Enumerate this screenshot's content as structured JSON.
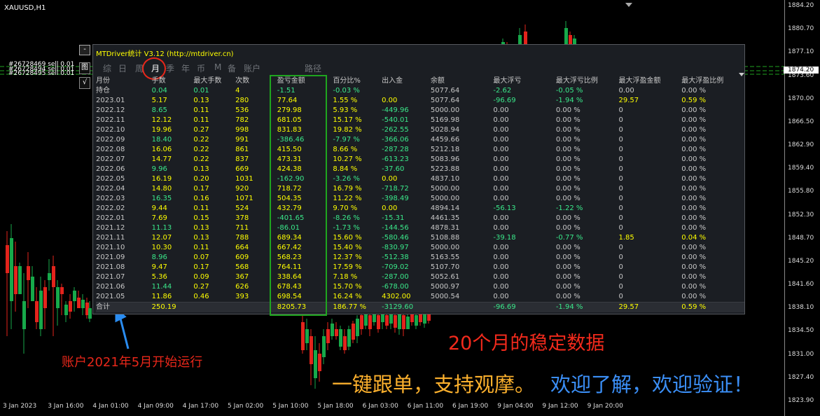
{
  "window": {
    "symbol": "XAUUSD,H1"
  },
  "colors": {
    "bull": "#17a94a",
    "bear": "#e3241c",
    "text_yellow": "#ffff00",
    "text_green": "#3ae88a",
    "box_green": "#1fa51f",
    "annotation_red": "#f22a1c",
    "annotation_orange": "#fbb02d",
    "annotation_blue": "#3b8ff7"
  },
  "price_axis": {
    "labels": [
      "1884.20",
      "1880.70",
      "1877.10",
      "1873.60",
      "1870.00",
      "1866.50",
      "1862.90",
      "1859.40",
      "1855.80",
      "1852.30",
      "1848.70",
      "1845.20",
      "1841.60",
      "1838.10",
      "1834.50",
      "1831.00",
      "1827.40",
      "1823.90"
    ],
    "current": "1874.20"
  },
  "time_axis": [
    "3 Jan 2023",
    "3 Jan 16:00",
    "4 Jan 01:00",
    "4 Jan 09:00",
    "4 Jan 17:00",
    "5 Jan 02:00",
    "5 Jan 10:00",
    "5 Jan 18:00",
    "6 Jan 03:00",
    "6 Jan 11:00",
    "6 Jan 19:00",
    "9 Jan 04:00",
    "9 Jan 12:00",
    "9 Jan 20:00"
  ],
  "orders": [
    "#26728469 sell 0.01",
    "#26728494 sell 0.01",
    "#26728495 sell 0.01"
  ],
  "panel": {
    "title": "MTDriver统计  V3.12 (http://mtdriver.cn)",
    "collapse_label": "-",
    "side_buttons": [
      "图",
      "√"
    ],
    "tabs": [
      "综",
      "日",
      "周",
      "月",
      "季",
      "年",
      "币",
      "M",
      "备",
      "账户",
      "路径"
    ],
    "active_tab": "月",
    "headers": [
      "月份",
      "手数",
      "最大手数",
      "次数",
      "盈亏金额",
      "百分比%",
      "出入金",
      "余额",
      "最大浮亏",
      "最大浮亏比例",
      "最大浮盈金额",
      "最大浮盈比例"
    ],
    "rows": [
      [
        "持仓",
        "0.04",
        "0.01",
        "4",
        "-1.51",
        "-0.03 %",
        "",
        "5077.64",
        "-2.62",
        "-0.05 %",
        "0.00",
        "0.00 %"
      ],
      [
        "2023.01",
        "5.17",
        "0.13",
        "280",
        "77.64",
        "1.55 %",
        "0.00",
        "5077.64",
        "-96.69",
        "-1.94 %",
        "29.57",
        "0.59 %"
      ],
      [
        "2022.12",
        "8.65",
        "0.11",
        "536",
        "279.98",
        "5.93 %",
        "-449.96",
        "5000.00",
        "0.00",
        "0.00 %",
        "0",
        "0.00 %"
      ],
      [
        "2022.11",
        "12.12",
        "0.11",
        "782",
        "681.05",
        "15.17 %",
        "-540.01",
        "5169.98",
        "0.00",
        "0.00 %",
        "0",
        "0.00 %"
      ],
      [
        "2022.10",
        "19.96",
        "0.27",
        "998",
        "831.83",
        "19.82 %",
        "-262.55",
        "5028.94",
        "0.00",
        "0.00 %",
        "0",
        "0.00 %"
      ],
      [
        "2022.09",
        "18.40",
        "0.22",
        "991",
        "-386.46",
        "-7.97 %",
        "-366.06",
        "4459.66",
        "0.00",
        "0.00 %",
        "0",
        "0.00 %"
      ],
      [
        "2022.08",
        "16.06",
        "0.22",
        "861",
        "415.50",
        "8.66 %",
        "-287.28",
        "5212.18",
        "0.00",
        "0.00 %",
        "0",
        "0.00 %"
      ],
      [
        "2022.07",
        "14.77",
        "0.22",
        "837",
        "473.31",
        "10.27 %",
        "-613.23",
        "5083.96",
        "0.00",
        "0.00 %",
        "0",
        "0.00 %"
      ],
      [
        "2022.06",
        "9.96",
        "0.13",
        "669",
        "424.38",
        "8.84 %",
        "-37.60",
        "5223.88",
        "0.00",
        "0.00 %",
        "0",
        "0.00 %"
      ],
      [
        "2022.05",
        "16.19",
        "0.20",
        "1031",
        "-162.90",
        "-3.26 %",
        "0.00",
        "4837.10",
        "0.00",
        "0.00 %",
        "0",
        "0.00 %"
      ],
      [
        "2022.04",
        "14.80",
        "0.17",
        "920",
        "718.72",
        "16.79 %",
        "-718.72",
        "5000.00",
        "0.00",
        "0.00 %",
        "0",
        "0.00 %"
      ],
      [
        "2022.03",
        "16.35",
        "0.16",
        "1071",
        "504.35",
        "11.22 %",
        "-398.49",
        "5000.00",
        "0.00",
        "0.00 %",
        "0",
        "0.00 %"
      ],
      [
        "2022.02",
        "9.44",
        "0.11",
        "524",
        "432.79",
        "9.70 %",
        "0.00",
        "4894.14",
        "-56.13",
        "-1.22 %",
        "0",
        "0.00 %"
      ],
      [
        "2022.01",
        "7.69",
        "0.15",
        "378",
        "-401.65",
        "-8.26 %",
        "-15.31",
        "4461.35",
        "0.00",
        "0.00 %",
        "0",
        "0.00 %"
      ],
      [
        "2021.12",
        "11.13",
        "0.13",
        "711",
        "-86.01",
        "-1.73 %",
        "-144.56",
        "4878.31",
        "0.00",
        "0.00 %",
        "0",
        "0.00 %"
      ],
      [
        "2021.11",
        "12.07",
        "0.13",
        "788",
        "689.34",
        "15.60 %",
        "-580.46",
        "5108.88",
        "-39.18",
        "-0.77 %",
        "1.85",
        "0.04 %"
      ],
      [
        "2021.10",
        "10.30",
        "0.11",
        "664",
        "667.42",
        "15.40 %",
        "-830.97",
        "5000.00",
        "0.00",
        "0.00 %",
        "0",
        "0.00 %"
      ],
      [
        "2021.09",
        "8.96",
        "0.07",
        "609",
        "568.23",
        "12.37 %",
        "-512.38",
        "5163.55",
        "0.00",
        "0.00 %",
        "0",
        "0.00 %"
      ],
      [
        "2021.08",
        "9.47",
        "0.17",
        "568",
        "764.11",
        "17.59 %",
        "-709.02",
        "5107.70",
        "0.00",
        "0.00 %",
        "0",
        "0.00 %"
      ],
      [
        "2021.07",
        "5.36",
        "0.09",
        "367",
        "338.64",
        "7.18 %",
        "-287.00",
        "5052.61",
        "0.00",
        "0.00 %",
        "0",
        "0.00 %"
      ],
      [
        "2021.06",
        "11.44",
        "0.27",
        "626",
        "678.43",
        "15.70 %",
        "-678.00",
        "5000.97",
        "0.00",
        "0.00 %",
        "0",
        "0.00 %"
      ],
      [
        "2021.05",
        "11.86",
        "0.46",
        "393",
        "698.54",
        "16.24 %",
        "4302.00",
        "5000.54",
        "0.00",
        "0.00 %",
        "0",
        "0.00 %"
      ]
    ],
    "total": [
      "合计",
      "250.19",
      "",
      "",
      "8205.73",
      "186.77 %",
      "-3129.60",
      "",
      "-96.69",
      "-1.94 %",
      "29.57",
      "0.59 %"
    ]
  },
  "annotations": {
    "stable": "20个月的稳定数据",
    "start": "账户2021年5月开始运行",
    "slogan_a": "一键跟单，支持观摩。",
    "slogan_b": "欢迎了解，欢迎验证！"
  }
}
